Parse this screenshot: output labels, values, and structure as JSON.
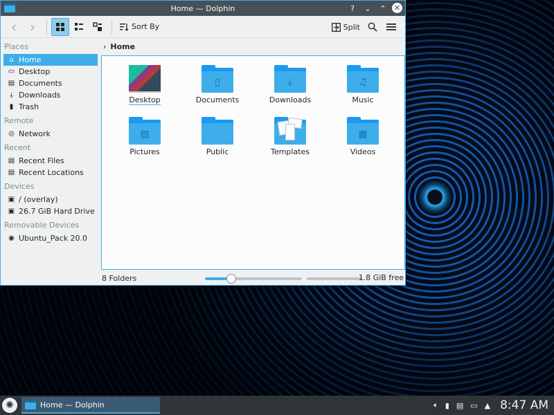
{
  "window": {
    "title": "Home — Dolphin",
    "help_glyph": "?",
    "minimize_glyph": "⌄",
    "maximize_glyph": "⌃",
    "close_glyph": "✕"
  },
  "toolbar": {
    "back_glyph": "‹",
    "forward_glyph": "›",
    "sort_label": "Sort By",
    "split_label": "Split"
  },
  "sidebar": {
    "places_title": "Places",
    "places": [
      {
        "label": "Home",
        "icon": "home-icon"
      },
      {
        "label": "Desktop",
        "icon": "desktop-icon"
      },
      {
        "label": "Documents",
        "icon": "documents-icon"
      },
      {
        "label": "Downloads",
        "icon": "downloads-icon"
      },
      {
        "label": "Trash",
        "icon": "trash-icon"
      }
    ],
    "remote_title": "Remote",
    "remote": [
      {
        "label": "Network",
        "icon": "network-icon"
      }
    ],
    "recent_title": "Recent",
    "recent": [
      {
        "label": "Recent Files",
        "icon": "recent-files-icon"
      },
      {
        "label": "Recent Locations",
        "icon": "recent-locations-icon"
      }
    ],
    "devices_title": "Devices",
    "devices": [
      {
        "label": "/ (overlay)",
        "icon": "overlay-drive-icon"
      },
      {
        "label": "26.7 GiB Hard Drive",
        "icon": "hard-drive-icon"
      }
    ],
    "removable_title": "Removable Devices",
    "removable": [
      {
        "label": "Ubuntu_Pack 20.0",
        "icon": "removable-drive-icon"
      }
    ]
  },
  "location": {
    "crumb": "Home"
  },
  "folders": [
    {
      "label": "Desktop"
    },
    {
      "label": "Documents"
    },
    {
      "label": "Downloads"
    },
    {
      "label": "Music"
    },
    {
      "label": "Pictures"
    },
    {
      "label": "Public"
    },
    {
      "label": "Templates"
    },
    {
      "label": "Videos"
    }
  ],
  "status": {
    "count": "8 Folders",
    "free": "1.8 GiB free",
    "zoom_fraction": 0.27,
    "used_fraction": 0.0
  },
  "taskbar": {
    "task_label": "Home — Dolphin",
    "clock": "8:47 AM"
  },
  "colors": {
    "accent": "#3daee9",
    "titlebar": "#475057",
    "folder": "#3daee9",
    "taskbar": "#2f3437"
  }
}
